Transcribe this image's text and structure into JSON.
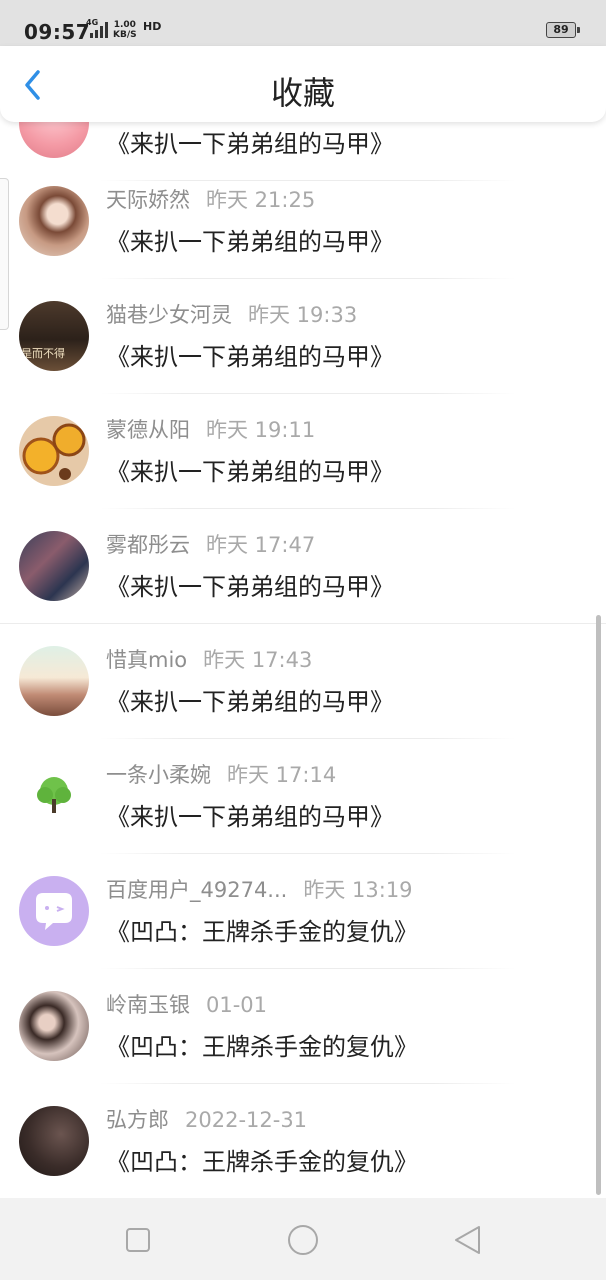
{
  "status_bar": {
    "time": "09:57",
    "network": "4G",
    "speed_value": "1.00",
    "speed_unit": "KB/S",
    "hd": "HD",
    "battery": "89"
  },
  "header": {
    "title": "收藏",
    "back_icon": "chevron-left-icon"
  },
  "colors": {
    "accent": "#2f8fe6",
    "text": "#222222",
    "meta": "#8e8e8e"
  },
  "items": [
    {
      "name": "",
      "time": "",
      "title": "《来扒一下弟弟组的马甲》",
      "avatar": "pink-cake"
    },
    {
      "name": "天际娇然",
      "time": "昨天 21:25",
      "title": "《来扒一下弟弟组的马甲》",
      "avatar": "girl-photo"
    },
    {
      "name": "猫巷少女河灵",
      "time": "昨天 19:33",
      "title": "《来扒一下弟弟组的马甲》",
      "avatar": "girl-dark-photo",
      "avatar_text": "是而不得"
    },
    {
      "name": "蒙德从阳",
      "time": "昨天 19:11",
      "title": "《来扒一下弟弟组的马甲》",
      "avatar": "cupcakes"
    },
    {
      "name": "雾都彤云",
      "time": "昨天 17:47",
      "title": "《来扒一下弟弟组的马甲》",
      "avatar": "boy-camera"
    },
    {
      "name": "惜真mio",
      "time": "昨天 17:43",
      "title": "《来扒一下弟弟组的马甲》",
      "avatar": "room-scene"
    },
    {
      "name": "一条小柔婉",
      "time": "昨天 17:14",
      "title": "《来扒一下弟弟组的马甲》",
      "avatar": "green-tree"
    },
    {
      "name": "百度用户_49274...",
      "time": "昨天 13:19",
      "title": "《凹凸：王牌杀手金的复仇》",
      "avatar": "chat-bubble-default"
    },
    {
      "name": "岭南玉银",
      "time": "01-01",
      "title": "《凹凸：王牌杀手金的复仇》",
      "avatar": "girl-lying"
    },
    {
      "name": "弘方郎",
      "time": "2022-12-31",
      "title": "《凹凸：王牌杀手金的复仇》",
      "avatar": "dark-portrait"
    }
  ],
  "nav_bar": {
    "recent_icon": "square-icon",
    "home_icon": "circle-icon",
    "back_icon": "triangle-back-icon"
  }
}
